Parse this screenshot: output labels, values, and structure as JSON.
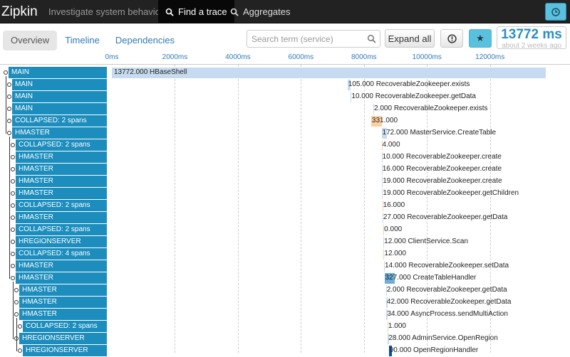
{
  "navbar": {
    "brand": "Zipkin",
    "tagline": "Investigate system behavior",
    "find_trace": "Find a trace",
    "aggregates": "Aggregates",
    "clock_icon": "clock-icon"
  },
  "toolbar": {
    "tabs": [
      "Overview",
      "Timeline",
      "Dependencies"
    ],
    "active_tab": "Overview",
    "search_placeholder": "Search term (service)",
    "expand_all": "Expand all",
    "duration": "13772 ms",
    "ago": "about 2 weeks ago"
  },
  "axis": {
    "ticks": [
      "0ms",
      "2000ms",
      "4000ms",
      "6000ms",
      "8000ms",
      "10000ms",
      "12000ms"
    ]
  },
  "spans": [
    {
      "service": "MAIN",
      "depth": 0,
      "duration": 13772.0,
      "start": 0,
      "label": "13772.000 HBaseShell"
    },
    {
      "service": "MAIN",
      "depth": 1,
      "duration": 105.0,
      "start": 7480,
      "label": "105.000 RecoverableZookeeper.exists"
    },
    {
      "service": "MAIN",
      "depth": 1,
      "duration": 10.0,
      "start": 7585,
      "label": "10.000 RecoverableZookeeper.getData"
    },
    {
      "service": "MAIN",
      "depth": 1,
      "duration": 2.0,
      "start": 8300,
      "label": "2.000 RecoverableZookeeper.exists"
    },
    {
      "service": "COLLAPSED: 2 spans",
      "depth": 1,
      "duration": 331.0,
      "start": 8230,
      "label": "331.000"
    },
    {
      "service": "HMASTER",
      "depth": 1,
      "duration": 172.0,
      "start": 8560,
      "label": "172.000 MasterService.CreateTable"
    },
    {
      "service": "COLLAPSED: 2 spans",
      "depth": 2,
      "duration": 4.0,
      "start": 8560,
      "label": "4.000"
    },
    {
      "service": "HMASTER",
      "depth": 2,
      "duration": 10.0,
      "start": 8560,
      "label": "10.000 RecoverableZookeeper.create"
    },
    {
      "service": "HMASTER",
      "depth": 2,
      "duration": 16.0,
      "start": 8565,
      "label": "16.000 RecoverableZookeeper.create"
    },
    {
      "service": "HMASTER",
      "depth": 2,
      "duration": 19.0,
      "start": 8575,
      "label": "19.000 RecoverableZookeeper.create"
    },
    {
      "service": "HMASTER",
      "depth": 2,
      "duration": 19.0,
      "start": 8580,
      "label": "19.000 RecoverableZookeeper.getChildren"
    },
    {
      "service": "COLLAPSED: 2 spans",
      "depth": 2,
      "duration": 16.0,
      "start": 8585,
      "label": "16.000"
    },
    {
      "service": "HMASTER",
      "depth": 2,
      "duration": 27.0,
      "start": 8590,
      "label": "27.000 RecoverableZookeeper.getData"
    },
    {
      "service": "COLLAPSED: 2 spans",
      "depth": 2,
      "duration": 0.0,
      "start": 8620,
      "label": "0.000"
    },
    {
      "service": "HREGIONSERVER",
      "depth": 2,
      "duration": 12.0,
      "start": 8620,
      "label": "12.000 ClientService.Scan"
    },
    {
      "service": "COLLAPSED: 4 spans",
      "depth": 2,
      "duration": 12.0,
      "start": 8625,
      "label": "12.000"
    },
    {
      "service": "HMASTER",
      "depth": 2,
      "duration": 14.0,
      "start": 8640,
      "label": "14.000 RecoverableZookeeper.setData"
    },
    {
      "service": "HMASTER",
      "depth": 2,
      "duration": 327.0,
      "start": 8650,
      "label": "327.000 CreateTableHandler"
    },
    {
      "service": "HMASTER",
      "depth": 3,
      "duration": 2.0,
      "start": 8700,
      "label": "2.000 RecoverableZookeeper.getData"
    },
    {
      "service": "HMASTER",
      "depth": 3,
      "duration": 42.0,
      "start": 8705,
      "label": "42.000 RecoverableZookeeper.getData"
    },
    {
      "service": "HMASTER",
      "depth": 3,
      "duration": 34.0,
      "start": 8715,
      "label": "34.000 AsyncProcess.sendMultiAction"
    },
    {
      "service": "COLLAPSED: 2 spans",
      "depth": 4,
      "duration": 1.0,
      "start": 8750,
      "label": "1.000"
    },
    {
      "service": "HREGIONSERVER",
      "depth": 3,
      "duration": 28.0,
      "start": 8760,
      "label": "28.000 AdminService.OpenRegion"
    },
    {
      "service": "HREGIONSERVER",
      "depth": 4,
      "duration": 90.0,
      "start": 8790,
      "label": "90.000 OpenRegionHandler"
    }
  ],
  "colors": {
    "navbar": "#222222",
    "service_label": "#1d8dbd",
    "accent": "#5bc0de",
    "bar_light": "#c6dbef",
    "bar_mid": "#6baed6",
    "bar_dark": "#08519c",
    "bar_orange": "#fdd0a2"
  }
}
